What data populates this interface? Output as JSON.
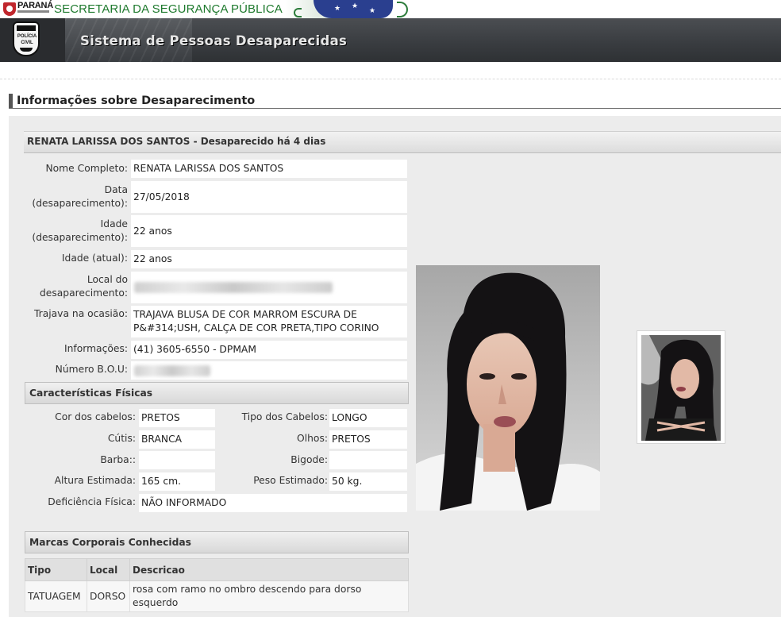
{
  "top_strip": {
    "state": "PARANÁ",
    "secretaria": "SECRETARIA DA SEGURANÇA PÚBLICA"
  },
  "header": {
    "badge_line1": "POLÍCIA",
    "badge_line2": "CIVIL",
    "title": "Sistema de Pessoas Desaparecidas"
  },
  "section_title": "Informações sobre Desaparecimento",
  "person_header": "RENATA LARISSA DOS SANTOS - Desaparecido há  4 dias",
  "details": [
    {
      "label": "Nome Completo:",
      "value": "RENATA LARISSA DOS SANTOS"
    },
    {
      "label": "Data (desaparecimento):",
      "value": "27/05/2018"
    },
    {
      "label": "Idade (desaparecimento):",
      "value": "22 anos"
    },
    {
      "label": "Idade (atual):",
      "value": "22 anos"
    },
    {
      "label": "Local do desaparecimento:",
      "value": ""
    },
    {
      "label": "Trajava na ocasião:",
      "value": "TRAJAVA BLUSA DE COR MARROM ESCURA DE P&#314;USH, CALÇA DE COR PRETA,TIPO CORINO"
    },
    {
      "label": "Informações:",
      "value": "(41) 3605-6550 - DPMAM"
    },
    {
      "label": "Número B.O.U:",
      "value": ""
    }
  ],
  "physical": {
    "title": "Características Físicas",
    "rows": [
      {
        "l1": "Cor dos cabelos:",
        "v1": "PRETOS",
        "l2": "Tipo dos Cabelos:",
        "v2": "LONGO"
      },
      {
        "l1": "Cútis:",
        "v1": "BRANCA",
        "l2": "Olhos:",
        "v2": "PRETOS"
      },
      {
        "l1": "Barba::",
        "v1": "",
        "l2": "Bigode:",
        "v2": ""
      },
      {
        "l1": "Altura Estimada:",
        "v1": "165 cm.",
        "l2": "Peso Estimado:",
        "v2": "50 kg."
      }
    ],
    "deficiency_label": "Deficiência Física:",
    "deficiency_value": "NÃO INFORMADO"
  },
  "marks": {
    "title": "Marcas Corporais Conhecidas",
    "columns": [
      "Tipo",
      "Local",
      "Descricao"
    ],
    "rows": [
      {
        "tipo": "TATUAGEM",
        "local": "DORSO",
        "descricao": "rosa com ramo no ombro descendo para dorso esquerdo"
      }
    ]
  },
  "colors": {
    "header_bg": "#3a3d41",
    "panel_bg": "#ececec",
    "secretaria_green": "#1f7a2e"
  }
}
